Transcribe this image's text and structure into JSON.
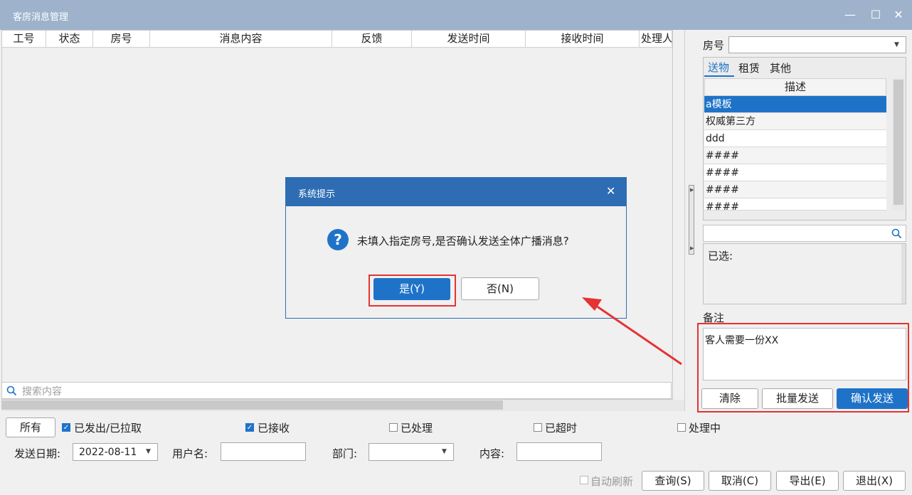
{
  "window": {
    "title": "客房消息管理",
    "minimize_icon": "—",
    "maximize_icon": "☐",
    "close_icon": "✕"
  },
  "grid": {
    "columns": [
      "工号",
      "状态",
      "房号",
      "消息内容",
      "反馈",
      "发送时间",
      "接收时间",
      "处理人"
    ],
    "rows": []
  },
  "search": {
    "placeholder": "搜索内容"
  },
  "filters": {
    "all_button": "所有",
    "checks": [
      {
        "label": "已发出/已拉取",
        "checked": true
      },
      {
        "label": "已接收",
        "checked": true
      },
      {
        "label": "已处理",
        "checked": false
      },
      {
        "label": "已超时",
        "checked": false
      },
      {
        "label": "处理中",
        "checked": false
      }
    ],
    "send_date_label": "发送日期:",
    "send_date_value": "2022-08-11",
    "username_label": "用户名:",
    "username_value": "",
    "dept_label": "部门:",
    "dept_value": "",
    "content_label": "内容:",
    "content_value": ""
  },
  "bottom_buttons": {
    "auto_refresh": "自动刷新",
    "query": "查询(S)",
    "cancel": "取消(C)",
    "export": "导出(E)",
    "exit": "退出(X)"
  },
  "right_panel": {
    "room_label": "房号",
    "room_value": "",
    "tabs": [
      "送物",
      "租赁",
      "其他"
    ],
    "active_tab": "送物",
    "desc_header": "描述",
    "desc_items": [
      "a模板",
      "权威第三方",
      "ddd",
      "####",
      "####",
      "####",
      "####"
    ],
    "selected_label": "已选:",
    "remark_label": "备注",
    "remark_value": "客人需要一份XX",
    "clear_button": "清除",
    "batch_send_button": "批量发送",
    "confirm_send_button": "确认发送"
  },
  "dialog": {
    "title": "系统提示",
    "message": "未填入指定房号,是否确认发送全体广播消息?",
    "yes_button": "是(Y)",
    "no_button": "否(N)"
  },
  "colors": {
    "accent": "#1e73c8",
    "title_bar": "#9eb3cb",
    "dialog_header": "#2e6db4",
    "highlight": "#e53333"
  }
}
